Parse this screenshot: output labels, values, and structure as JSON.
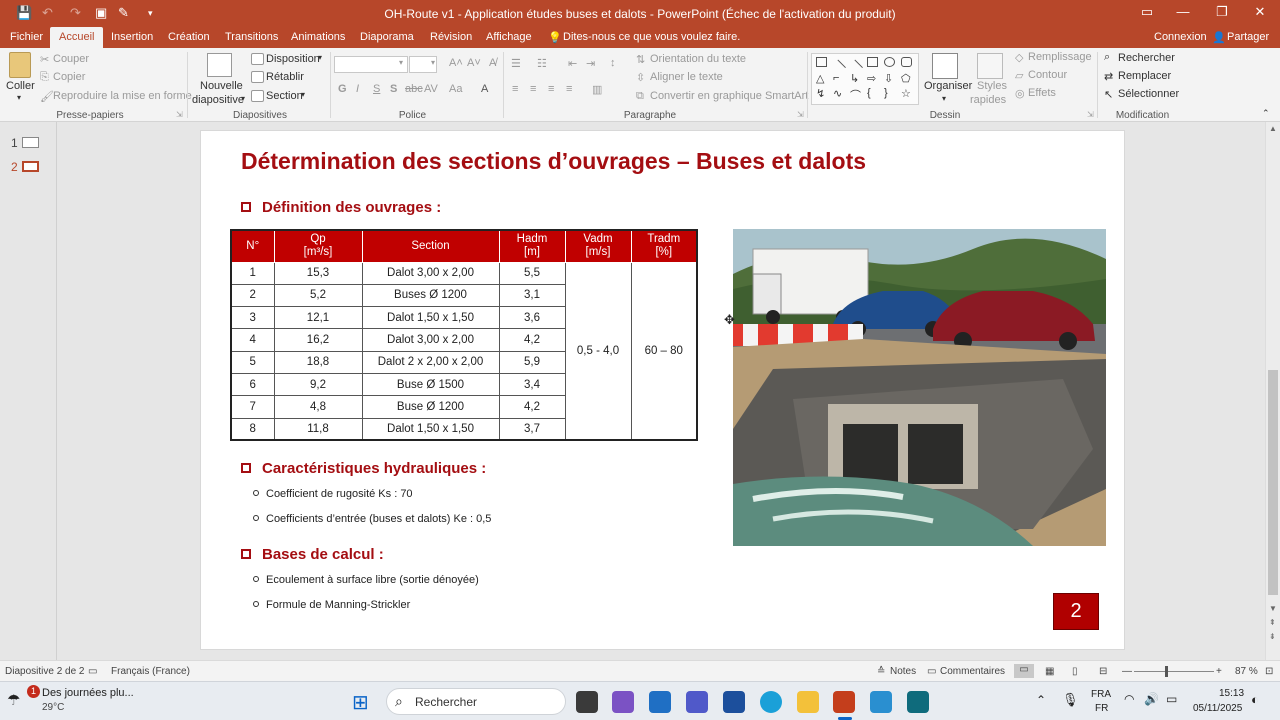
{
  "app": {
    "title": "OH-Route v1 - Application études buses et dalots - PowerPoint (Échec de l'activation du produit)"
  },
  "tabs": [
    {
      "label": "Fichier"
    },
    {
      "label": "Accueil"
    },
    {
      "label": "Insertion"
    },
    {
      "label": "Création"
    },
    {
      "label": "Transitions"
    },
    {
      "label": "Animations"
    },
    {
      "label": "Diaporama"
    },
    {
      "label": "Révision"
    },
    {
      "label": "Affichage"
    },
    {
      "label": "Dites-nous ce que vous voulez faire."
    },
    {
      "label": "Connexion"
    },
    {
      "label": "Partager"
    }
  ],
  "ribbon": {
    "clipboard": {
      "paste": "Coller",
      "cut": "Couper",
      "copy": "Copier",
      "format_painter": "Reproduire la mise en forme",
      "group": "Presse-papiers"
    },
    "slides": {
      "new_slide_1": "Nouvelle",
      "new_slide_2": "diapositive",
      "layout": "Disposition",
      "reset": "Rétablir",
      "section": "Section",
      "group": "Diapositives"
    },
    "font": {
      "group": "Police"
    },
    "paragraph": {
      "text_direction": "Orientation du texte",
      "align_text": "Aligner le texte",
      "smartart": "Convertir en graphique SmartArt",
      "group": "Paragraphe"
    },
    "drawing": {
      "arrange": "Organiser",
      "styles_1": "Styles",
      "styles_2": "rapides",
      "fill": "Remplissage",
      "outline": "Contour",
      "effects": "Effets",
      "group": "Dessin"
    },
    "editing": {
      "find": "Rechercher",
      "replace": "Remplacer",
      "select": "Sélectionner",
      "group": "Modification"
    }
  },
  "thumbnails": [
    {
      "num": "1"
    },
    {
      "num": "2"
    }
  ],
  "slide": {
    "title": "Détermination des sections d’ouvrages – Buses et dalots",
    "section1": "Définition des ouvrages :",
    "table": {
      "headers": [
        {
          "l1": "N°",
          "l2": ""
        },
        {
          "l1": "Qp",
          "l2": "[m³/s]"
        },
        {
          "l1": "Section",
          "l2": ""
        },
        {
          "l1": "Hadm",
          "l2": "[m]"
        },
        {
          "l1": "Vadm",
          "l2": "[m/s]"
        },
        {
          "l1": "Tradm",
          "l2": "[%]"
        }
      ],
      "rows": [
        {
          "n": "1",
          "qp": "15,3",
          "section": "Dalot 3,00 x 2,00",
          "hadm": "5,5"
        },
        {
          "n": "2",
          "qp": "5,2",
          "section": "Buses Ø 1200",
          "hadm": "3,1"
        },
        {
          "n": "3",
          "qp": "12,1",
          "section": "Dalot 1,50 x 1,50",
          "hadm": "3,6"
        },
        {
          "n": "4",
          "qp": "16,2",
          "section": "Dalot 3,00 x 2,00",
          "hadm": "4,2"
        },
        {
          "n": "5",
          "qp": "18,8",
          "section": "Dalot 2 x 2,00 x 2,00",
          "hadm": "5,9"
        },
        {
          "n": "6",
          "qp": "9,2",
          "section": "Buse Ø 1500",
          "hadm": "3,4"
        },
        {
          "n": "7",
          "qp": "4,8",
          "section": "Buse Ø 1200",
          "hadm": "4,2"
        },
        {
          "n": "8",
          "qp": "11,8",
          "section": "Dalot 1,50 x 1,50",
          "hadm": "3,7"
        }
      ],
      "vadm": "0,5 - 4,0",
      "tradm": "60 – 80"
    },
    "section2": "Caractéristiques hydrauliques :",
    "hydraulic": [
      "Coefficient de rugosité Ks : 70",
      "Coefficients d’entrée (buses et dalots) Ke : 0,5"
    ],
    "section3": "Bases de calcul :",
    "bases": [
      "Ecoulement à surface libre (sortie dénoyée)",
      "Formule de Manning-Strickler"
    ],
    "page_number": "2"
  },
  "status": {
    "slide_info": "Diapositive 2 de 2",
    "language": "Français (France)",
    "notes": "Notes",
    "comments": "Commentaires",
    "zoom": "87 %"
  },
  "taskbar": {
    "weather_title": "Des journées plu...",
    "weather_temp": "29°C",
    "weather_badge": "1",
    "search": "Rechercher",
    "lang1": "FRA",
    "lang2": "FR",
    "time": "15:13",
    "date": "05/11/2025"
  },
  "colors": {
    "accent": "#b7472a",
    "title_red": "#a40e12",
    "table_header": "#c00000"
  }
}
